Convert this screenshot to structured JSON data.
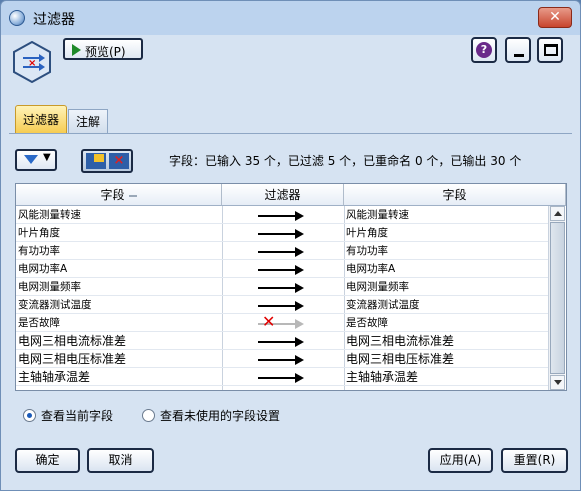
{
  "window": {
    "title": "过滤器",
    "close_label": "✕"
  },
  "toolbar": {
    "preview_label": "预览(P)"
  },
  "tabs": [
    {
      "label": "过滤器"
    },
    {
      "label": "注解"
    }
  ],
  "summary": "字段：已输入 35 个，已过滤 5 个，已重命名 0 个，已输出 30 个",
  "table": {
    "headers": [
      "字段",
      "过滤器",
      "字段"
    ],
    "rows": [
      {
        "input": "风能测量转速",
        "status": "pass",
        "output": "风能测量转速"
      },
      {
        "input": "叶片角度",
        "status": "pass",
        "output": "叶片角度"
      },
      {
        "input": "有功功率",
        "status": "pass",
        "output": "有功功率"
      },
      {
        "input": "电网功率A",
        "status": "pass",
        "output": "电网功率A"
      },
      {
        "input": "电网测量频率",
        "status": "pass",
        "output": "电网测量频率"
      },
      {
        "input": "变流器测试温度",
        "status": "pass",
        "output": "变流器测试温度"
      },
      {
        "input": "是否故障",
        "status": "filtered",
        "output": "是否故障"
      },
      {
        "input": "电网三相电流标准差",
        "status": "pass",
        "output": "电网三相电流标准差"
      },
      {
        "input": "电网三相电压标准差",
        "status": "pass",
        "output": "电网三相电压标准差"
      },
      {
        "input": "主轴轴承温差",
        "status": "pass",
        "output": "主轴轴承温差"
      }
    ]
  },
  "view_options": [
    {
      "label": "查看当前字段",
      "selected": true
    },
    {
      "label": "查看未使用的字段设置",
      "selected": false
    }
  ],
  "buttons": {
    "ok": "确定",
    "cancel": "取消",
    "apply": "应用(A)",
    "reset": "重置(R)"
  },
  "icons": {
    "app": "filter-node-icon",
    "node": "filter-node-icon",
    "play": "play-icon",
    "help": "help-icon",
    "minimize": "minimize-icon",
    "maximize": "maximize-icon",
    "funnel": "funnel-icon",
    "pass": "arrow-icon",
    "filtered": "x-arrow-icon"
  },
  "colors": {
    "accent": "#1a5ab8",
    "filtered_x": "#e00000",
    "active_tab": "#f6cc52"
  }
}
